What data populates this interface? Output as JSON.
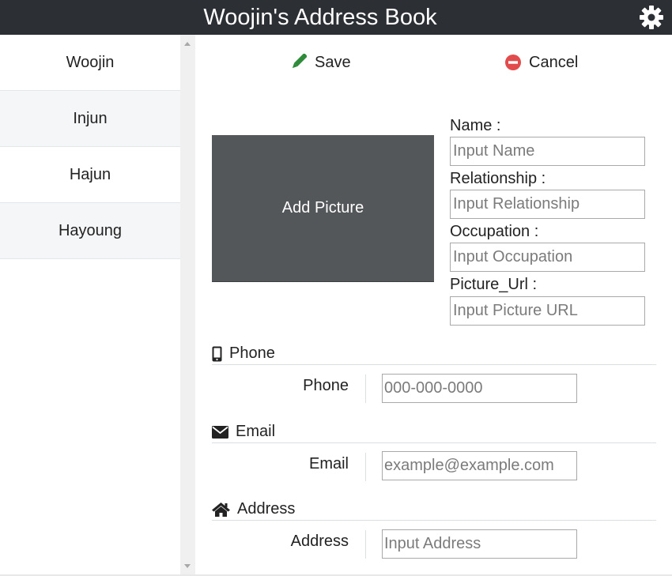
{
  "header": {
    "title": "Woojin's Address Book"
  },
  "sidebar": {
    "items": [
      {
        "label": "Woojin"
      },
      {
        "label": "Injun"
      },
      {
        "label": "Hajun"
      },
      {
        "label": "Hayoung"
      }
    ]
  },
  "toolbar": {
    "save_label": "Save",
    "cancel_label": "Cancel"
  },
  "picture": {
    "label": "Add Picture"
  },
  "form": {
    "name_label": "Name :",
    "name_placeholder": "Input Name",
    "relationship_label": "Relationship :",
    "relationship_placeholder": "Input Relationship",
    "occupation_label": "Occupation :",
    "occupation_placeholder": "Input Occupation",
    "picture_url_label": "Picture_Url :",
    "picture_url_placeholder": "Input Picture URL"
  },
  "sections": {
    "phone": {
      "heading": "Phone",
      "label": "Phone",
      "placeholder": "000-000-0000",
      "icon": "mobile-phone-icon"
    },
    "email": {
      "heading": "Email",
      "label": "Email",
      "placeholder": "example@example.com",
      "icon": "envelope-icon"
    },
    "address": {
      "heading": "Address",
      "label": "Address",
      "placeholder": "Input Address",
      "icon": "home-icon"
    }
  },
  "colors": {
    "header_bg": "#2c3034",
    "save_icon": "#2e8b3a",
    "cancel_icon": "#e24b4b",
    "picture_bg": "#545759",
    "sidebar_alt_bg": "#f5f6f8"
  }
}
